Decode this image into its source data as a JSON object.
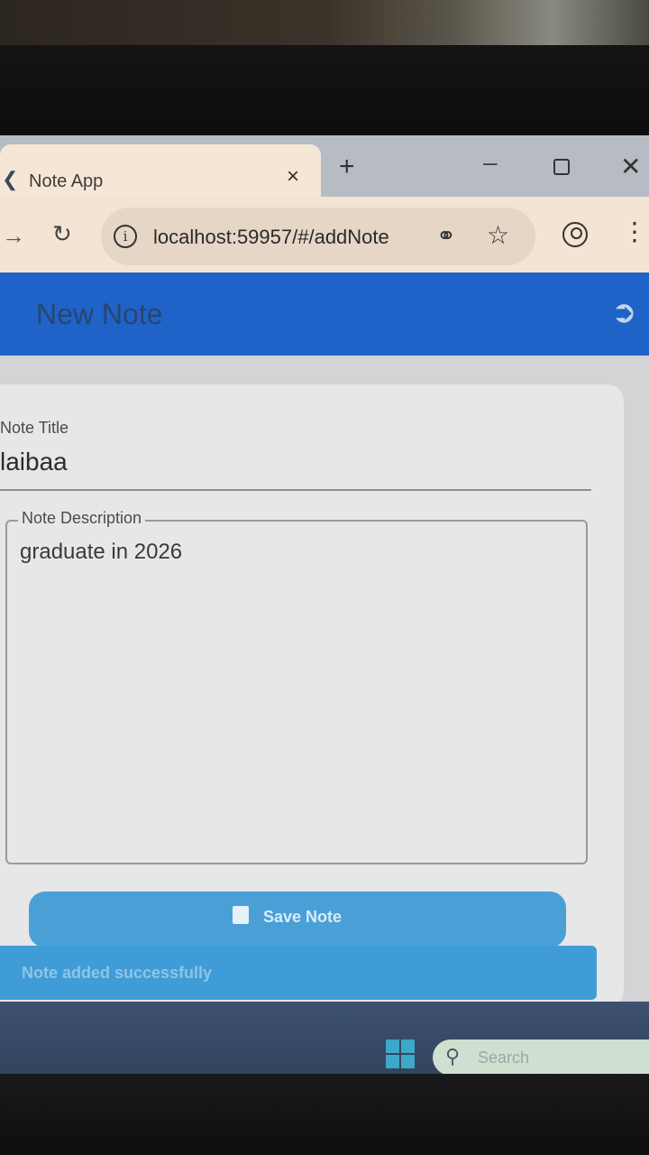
{
  "browser": {
    "tab_title": "Note App",
    "tab_close": "×",
    "new_tab": "+",
    "url": "localhost:59957/#/addNote",
    "win_minimize": "–",
    "win_close": "✕"
  },
  "appbar": {
    "title": "New Note"
  },
  "form": {
    "title_label": "Note Title",
    "title_value": "laibaa",
    "description_label": "Note Description",
    "description_value": "graduate in 2026",
    "save_label": "Save Note"
  },
  "snackbar": {
    "message": "Note added successfully"
  },
  "taskbar": {
    "search_placeholder": "Search"
  },
  "colors": {
    "appbar": "#1f62c8",
    "button": "#4aa0d6",
    "snackbar": "#3f9cd6"
  }
}
